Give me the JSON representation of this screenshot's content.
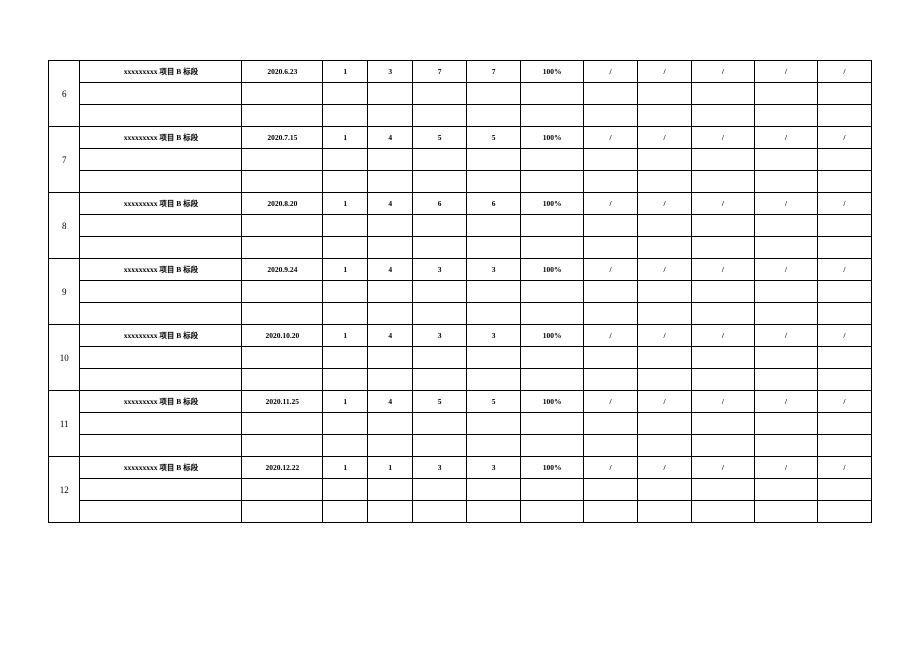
{
  "rows": [
    {
      "idx": "6",
      "name": "xxxxxxxxx 项目 B 标段",
      "date": "2020.6.23",
      "c1": "1",
      "c2": "3",
      "c3": "7",
      "c4": "7",
      "pct": "100%",
      "s1": "/",
      "s2": "/",
      "s3": "/",
      "s4": "/",
      "s5": "/"
    },
    {
      "idx": "7",
      "name": "xxxxxxxxx 项目 B 标段",
      "date": "2020.7.15",
      "c1": "1",
      "c2": "4",
      "c3": "5",
      "c4": "5",
      "pct": "100%",
      "s1": "/",
      "s2": "/",
      "s3": "/",
      "s4": "/",
      "s5": "/"
    },
    {
      "idx": "8",
      "name": "xxxxxxxxx 项目 B 标段",
      "date": "2020.8.20",
      "c1": "1",
      "c2": "4",
      "c3": "6",
      "c4": "6",
      "pct": "100%",
      "s1": "/",
      "s2": "/",
      "s3": "/",
      "s4": "/",
      "s5": "/"
    },
    {
      "idx": "9",
      "name": "xxxxxxxxx 项目 B 标段",
      "date": "2020.9.24",
      "c1": "1",
      "c2": "4",
      "c3": "3",
      "c4": "3",
      "pct": "100%",
      "s1": "/",
      "s2": "/",
      "s3": "/",
      "s4": "/",
      "s5": "/"
    },
    {
      "idx": "10",
      "name": "xxxxxxxxx 项目 B 标段",
      "date": "2020.10.20",
      "c1": "1",
      "c2": "4",
      "c3": "3",
      "c4": "3",
      "pct": "100%",
      "s1": "/",
      "s2": "/",
      "s3": "/",
      "s4": "/",
      "s5": "/"
    },
    {
      "idx": "11",
      "name": "xxxxxxxxx 项目 B 标段",
      "date": "2020.11.25",
      "c1": "1",
      "c2": "4",
      "c3": "5",
      "c4": "5",
      "pct": "100%",
      "s1": "/",
      "s2": "/",
      "s3": "/",
      "s4": "/",
      "s5": "/"
    },
    {
      "idx": "12",
      "name": "xxxxxxxxx 项目 B 标段",
      "date": "2020.12.22",
      "c1": "1",
      "c2": "1",
      "c3": "3",
      "c4": "3",
      "pct": "100%",
      "s1": "/",
      "s2": "/",
      "s3": "/",
      "s4": "/",
      "s5": "/"
    }
  ]
}
